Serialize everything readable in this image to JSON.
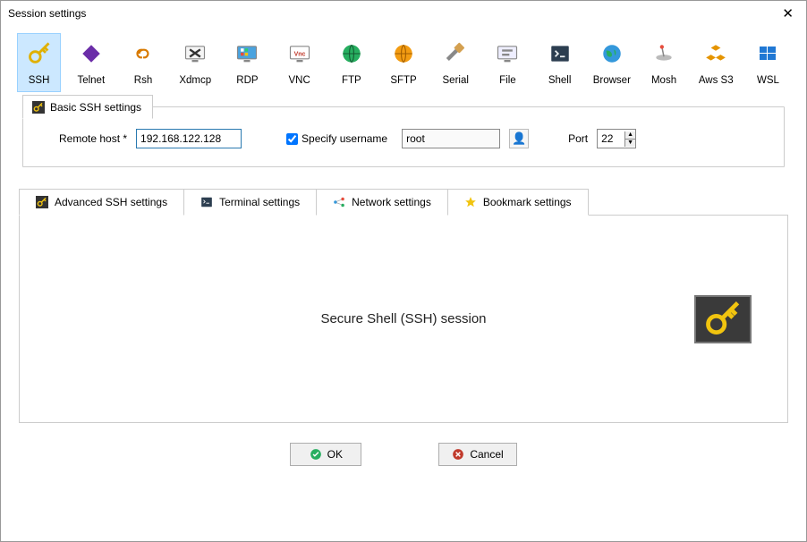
{
  "window": {
    "title": "Session settings"
  },
  "session_types": [
    {
      "id": "ssh",
      "label": "SSH",
      "selected": true
    },
    {
      "id": "telnet",
      "label": "Telnet",
      "selected": false
    },
    {
      "id": "rsh",
      "label": "Rsh",
      "selected": false
    },
    {
      "id": "xdmcp",
      "label": "Xdmcp",
      "selected": false
    },
    {
      "id": "rdp",
      "label": "RDP",
      "selected": false
    },
    {
      "id": "vnc",
      "label": "VNC",
      "selected": false
    },
    {
      "id": "ftp",
      "label": "FTP",
      "selected": false
    },
    {
      "id": "sftp",
      "label": "SFTP",
      "selected": false
    },
    {
      "id": "serial",
      "label": "Serial",
      "selected": false
    },
    {
      "id": "file",
      "label": "File",
      "selected": false
    },
    {
      "id": "shell",
      "label": "Shell",
      "selected": false
    },
    {
      "id": "browser",
      "label": "Browser",
      "selected": false
    },
    {
      "id": "mosh",
      "label": "Mosh",
      "selected": false
    },
    {
      "id": "awss3",
      "label": "Aws S3",
      "selected": false
    },
    {
      "id": "wsl",
      "label": "WSL",
      "selected": false
    }
  ],
  "basic_tab": {
    "label": "Basic SSH settings"
  },
  "form": {
    "remote_host_label": "Remote host *",
    "remote_host_value": "192.168.122.128",
    "specify_user_label": "Specify username",
    "specify_user_checked": true,
    "user_value": "root",
    "port_label": "Port",
    "port_value": "22"
  },
  "subtabs": {
    "advanced": "Advanced SSH settings",
    "terminal": "Terminal settings",
    "network": "Network settings",
    "bookmark": "Bookmark settings"
  },
  "panel": {
    "title": "Secure Shell (SSH) session"
  },
  "buttons": {
    "ok": "OK",
    "cancel": "Cancel"
  }
}
